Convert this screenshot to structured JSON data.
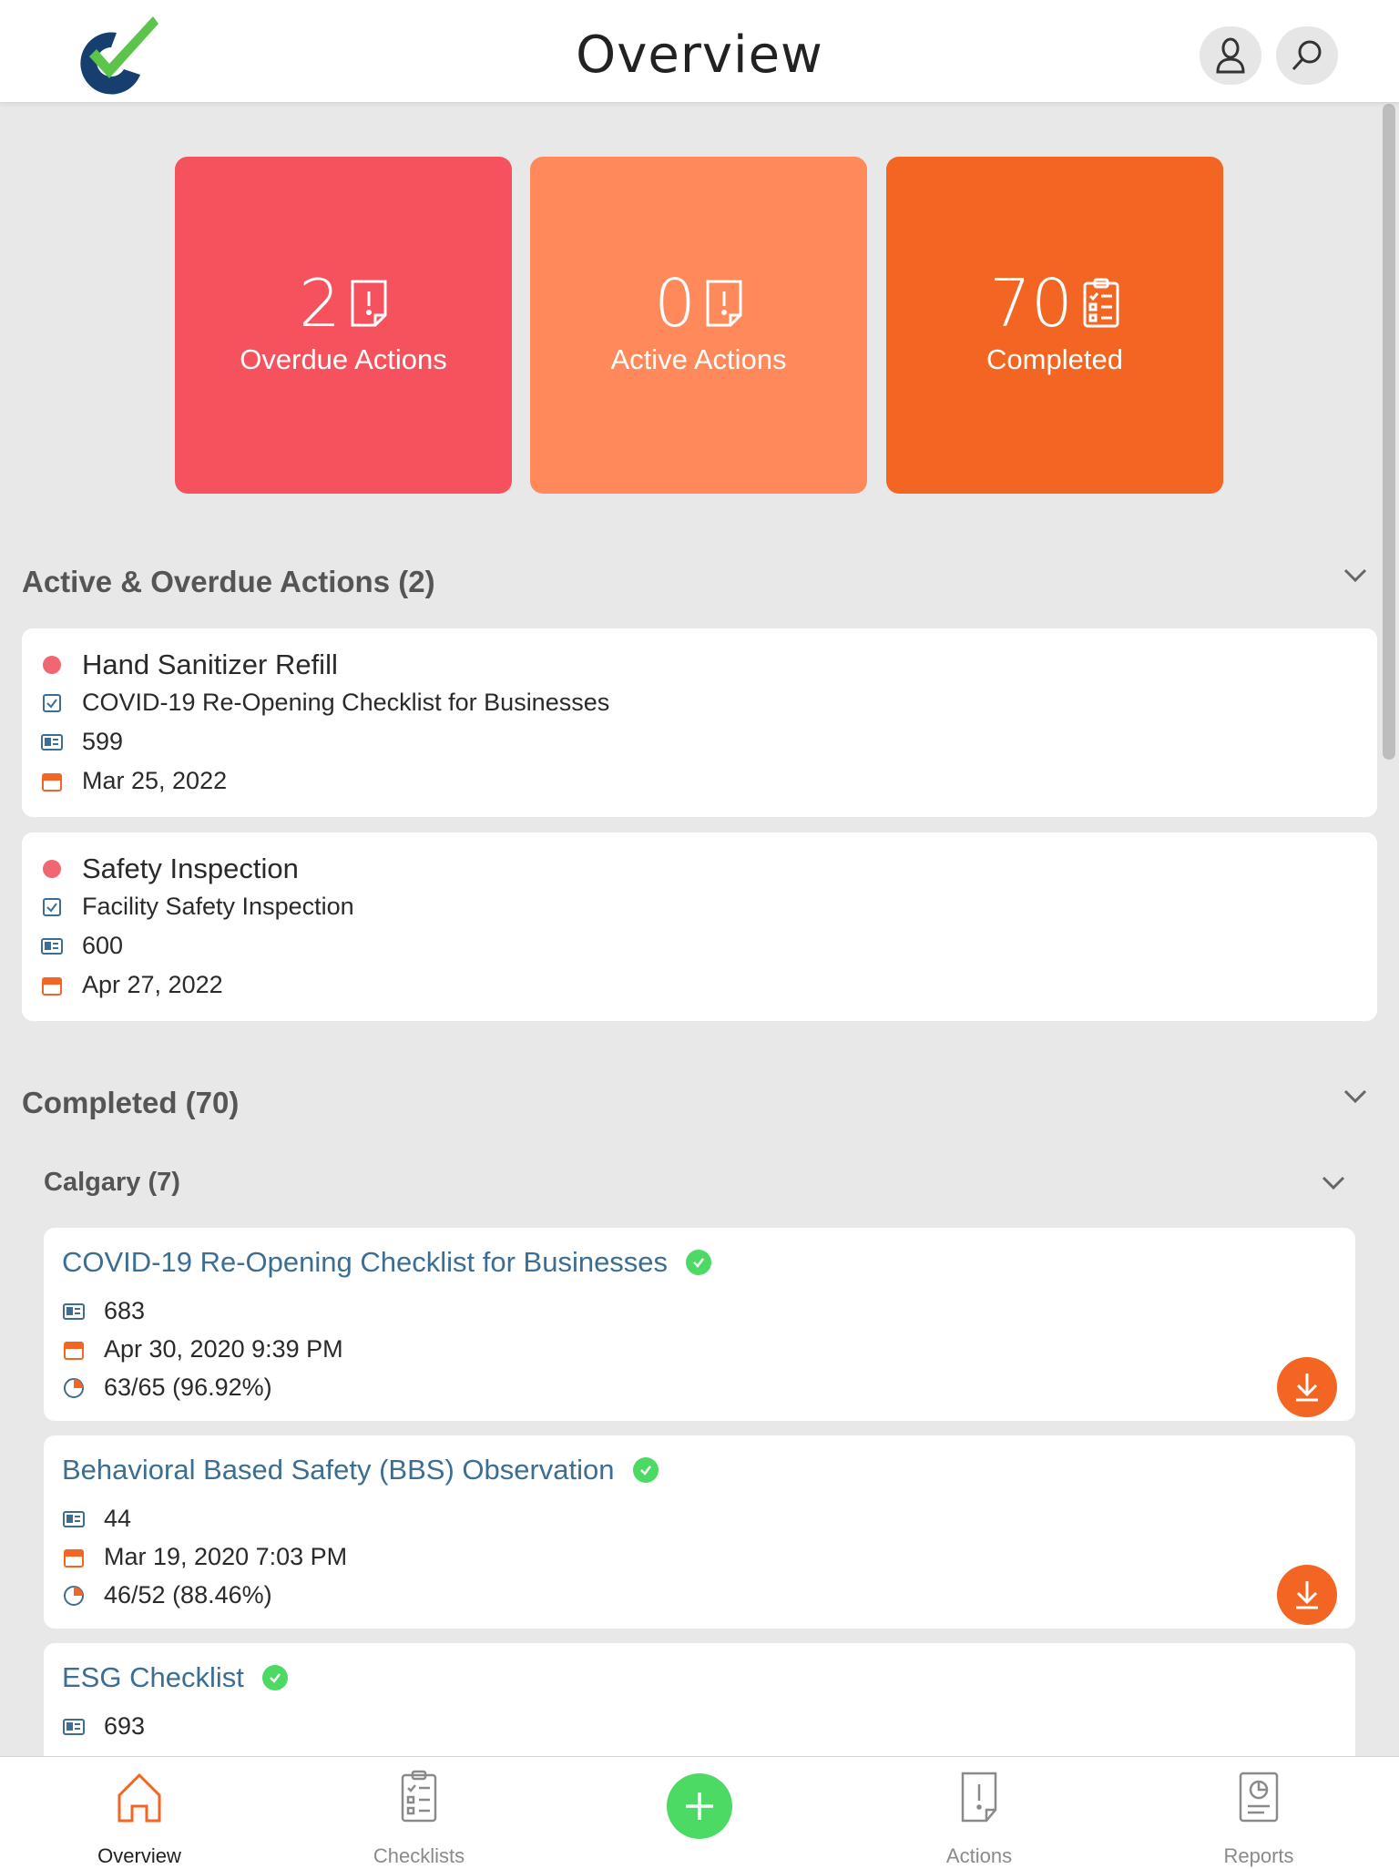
{
  "header": {
    "title": "Overview"
  },
  "tiles": {
    "overdue": {
      "count": "2",
      "label": "Overdue Actions"
    },
    "active": {
      "count": "0",
      "label": "Active Actions"
    },
    "completed": {
      "count": "70",
      "label": "Completed"
    }
  },
  "active_section": {
    "title": "Active & Overdue Actions (2)",
    "actions": [
      {
        "title": "Hand Sanitizer Refill",
        "checklist": "COVID-19 Re-Opening Checklist for Businesses",
        "id": "599",
        "date": "Mar 25, 2022"
      },
      {
        "title": "Safety Inspection",
        "checklist": "Facility Safety Inspection",
        "id": "600",
        "date": "Apr 27, 2022"
      }
    ]
  },
  "completed_section": {
    "title": "Completed (70)",
    "group": {
      "title": "Calgary (7)",
      "items": [
        {
          "title": "COVID-19 Re-Opening Checklist for Businesses",
          "id": "683",
          "date": "Apr 30, 2020 9:39 PM",
          "score": "63/65 (96.92%)"
        },
        {
          "title": "Behavioral Based Safety (BBS) Observation",
          "id": "44",
          "date": "Mar 19, 2020 7:03 PM",
          "score": "46/52 (88.46%)"
        },
        {
          "title": "ESG Checklist",
          "id": "693"
        }
      ]
    }
  },
  "nav": {
    "overview": "Overview",
    "checklists": "Checklists",
    "actions": "Actions",
    "reports": "Reports"
  },
  "colors": {
    "overdue": "#f5525e",
    "active": "#ff895a",
    "completed": "#f26522",
    "success": "#4cd964",
    "link": "#3b6e92"
  }
}
